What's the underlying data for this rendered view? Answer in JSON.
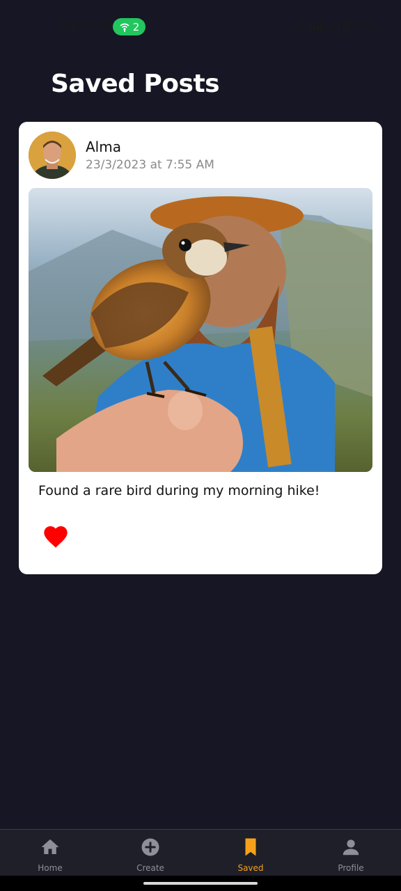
{
  "status_bar": {
    "time": "08:40:01",
    "hotspot_count": "2",
    "net_speed_top": "0.40",
    "net_speed_bottom": "KB/S",
    "battery": "93%"
  },
  "page": {
    "title": "Saved Posts"
  },
  "post": {
    "author": "Alma",
    "timestamp": "23/3/2023 at 7:55 AM",
    "caption": "Found a rare bird during my morning hike!",
    "liked": true,
    "like_color": "#ff0000"
  },
  "bottom_nav": {
    "items": [
      {
        "label": "Home",
        "icon": "home-icon",
        "active": false
      },
      {
        "label": "Create",
        "icon": "plus-circle-icon",
        "active": false
      },
      {
        "label": "Saved",
        "icon": "bookmark-icon",
        "active": true
      },
      {
        "label": "Profile",
        "icon": "person-icon",
        "active": false
      }
    ],
    "active_color": "#f5a21a",
    "inactive_color": "#8f8f99"
  }
}
